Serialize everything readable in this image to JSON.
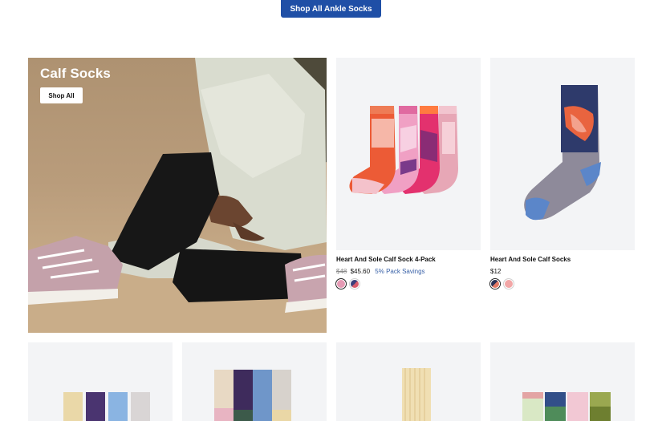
{
  "top_button": {
    "label": "Shop All Ankle Socks"
  },
  "hero": {
    "title": "Calf Socks",
    "button_label": "Shop All"
  },
  "products": [
    {
      "title": "Heart And Sole Calf Sock 4-Pack",
      "price_original": "$48",
      "price_current": "$45.60",
      "savings": "5% Pack Savings",
      "swatches": [
        "#e59ab4",
        "#3b3f7a"
      ]
    },
    {
      "title": "Heart And Sole Calf Socks",
      "price_current": "$12",
      "swatches": [
        "#2c3357",
        "#f2a6a6"
      ]
    }
  ],
  "colors": {
    "accent": "#1f4fa6",
    "card_bg": "#f3f4f6",
    "savings": "#3a62a8"
  }
}
